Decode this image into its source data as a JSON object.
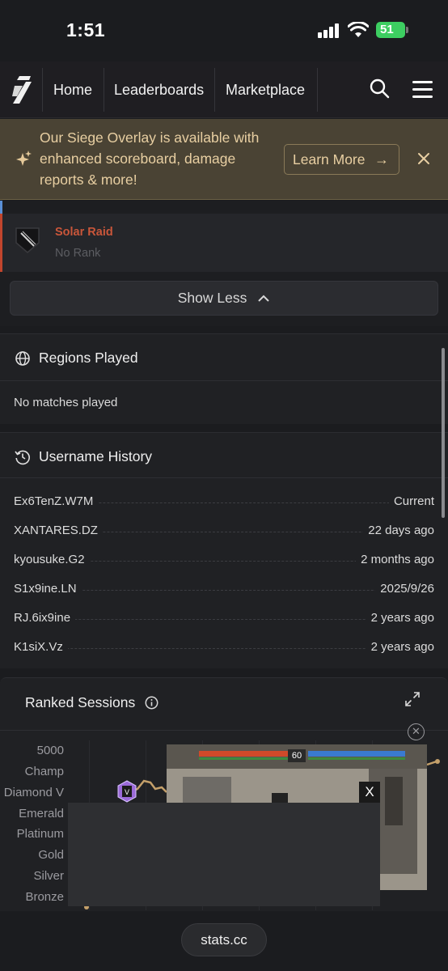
{
  "status_bar": {
    "time": "1:51",
    "battery": "51"
  },
  "nav": {
    "links": [
      "Home",
      "Leaderboards",
      "Marketplace"
    ]
  },
  "banner": {
    "message": "Our Siege Overlay is available with enhanced scoreboard, damage reports & more!",
    "button_label": "Learn More",
    "button_arrow": "→",
    "close_glyph": "✕"
  },
  "rank_card": {
    "name": "Solar Raid",
    "rank": "No Rank"
  },
  "show_less": {
    "label": "Show Less",
    "chevron": "⌃"
  },
  "regions": {
    "title": "Regions Played",
    "empty": "No matches played"
  },
  "username_history": {
    "title": "Username History",
    "rows": [
      {
        "name": "Ex6TenZ.W7M",
        "date": "Current"
      },
      {
        "name": "XANTARES.DZ",
        "date": "22 days ago"
      },
      {
        "name": "kyousuke.G2",
        "date": "2 months ago"
      },
      {
        "name": "S1x9ine.LN",
        "date": "2025/9/26"
      },
      {
        "name": "RJ.6ix9ine",
        "date": "2 years ago"
      },
      {
        "name": "K1siX.Vz",
        "date": "2 years ago"
      }
    ]
  },
  "ranked_sessions": {
    "title": "Ranked Sessions",
    "y_labels": [
      "5000",
      "Champ",
      "Diamond V",
      "Emerald",
      "Platinum",
      "Gold",
      "Silver",
      "Bronze"
    ]
  },
  "ad": {
    "close_label": "X",
    "timer": "60",
    "dismiss_glyph": "✕"
  },
  "bottom": {
    "url": "stats.cc"
  },
  "colors": {
    "accent_rank": "#c9563a",
    "banner_bg": "#4a4334",
    "banner_text": "#e8cfa2"
  }
}
